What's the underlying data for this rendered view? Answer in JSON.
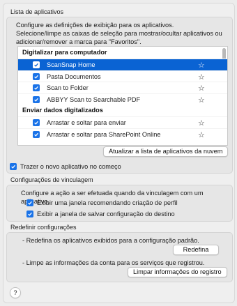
{
  "app_list": {
    "section_title": "Lista de aplicativos",
    "description_line1": "Configure as definições de exibição para os aplicativos.",
    "description_line2": "Selecione/limpe as caixas de seleção para mostrar/ocultar aplicativos ou",
    "description_line3": "adicionar/remover a marca para \"Favoritos\".",
    "group1_header": "Digitalizar para computador",
    "group1_items": [
      {
        "label": "ScanSnap Home",
        "checked": true,
        "selected": true
      },
      {
        "label": "Pasta Documentos",
        "checked": true
      },
      {
        "label": "Scan to Folder",
        "checked": true
      },
      {
        "label": "ABBYY Scan to Searchable PDF",
        "checked": true
      }
    ],
    "group2_header": "Enviar dados digitalizados",
    "group2_items": [
      {
        "label": "Arrastar e soltar para enviar",
        "checked": true
      },
      {
        "label": "Arrastar e soltar para SharePoint Online",
        "checked": true
      }
    ],
    "update_button": "Atualizar a lista de aplicativos da nuvem",
    "bring_new_app_first": "Trazer o novo aplicativo no começo"
  },
  "link_settings": {
    "section_title": "Configurações de vinculagem",
    "description": "Configure a ação a ser efetuada quando da vinculagem com um aplicativo.",
    "option1": "Exibir uma janela recomendando criação de perfil",
    "option2": "Exibir a janela de salvar configuração do destino"
  },
  "reset_settings": {
    "section_title": "Redefinir configurações",
    "text1": "- Redefina os aplicativos exibidos para a configuração padrão.",
    "reset_button": "Redefina",
    "text2": "- Limpe as informações da conta para os serviços que registrou.",
    "clear_button": "Limpar informações do registro"
  },
  "help_button": "?",
  "colors": {
    "accent": "#1a73e8",
    "selection": "#0a63d3",
    "panel": "#e6e6e6"
  },
  "icons": {
    "star": "star-outline-icon",
    "check": "checkmark-icon"
  }
}
